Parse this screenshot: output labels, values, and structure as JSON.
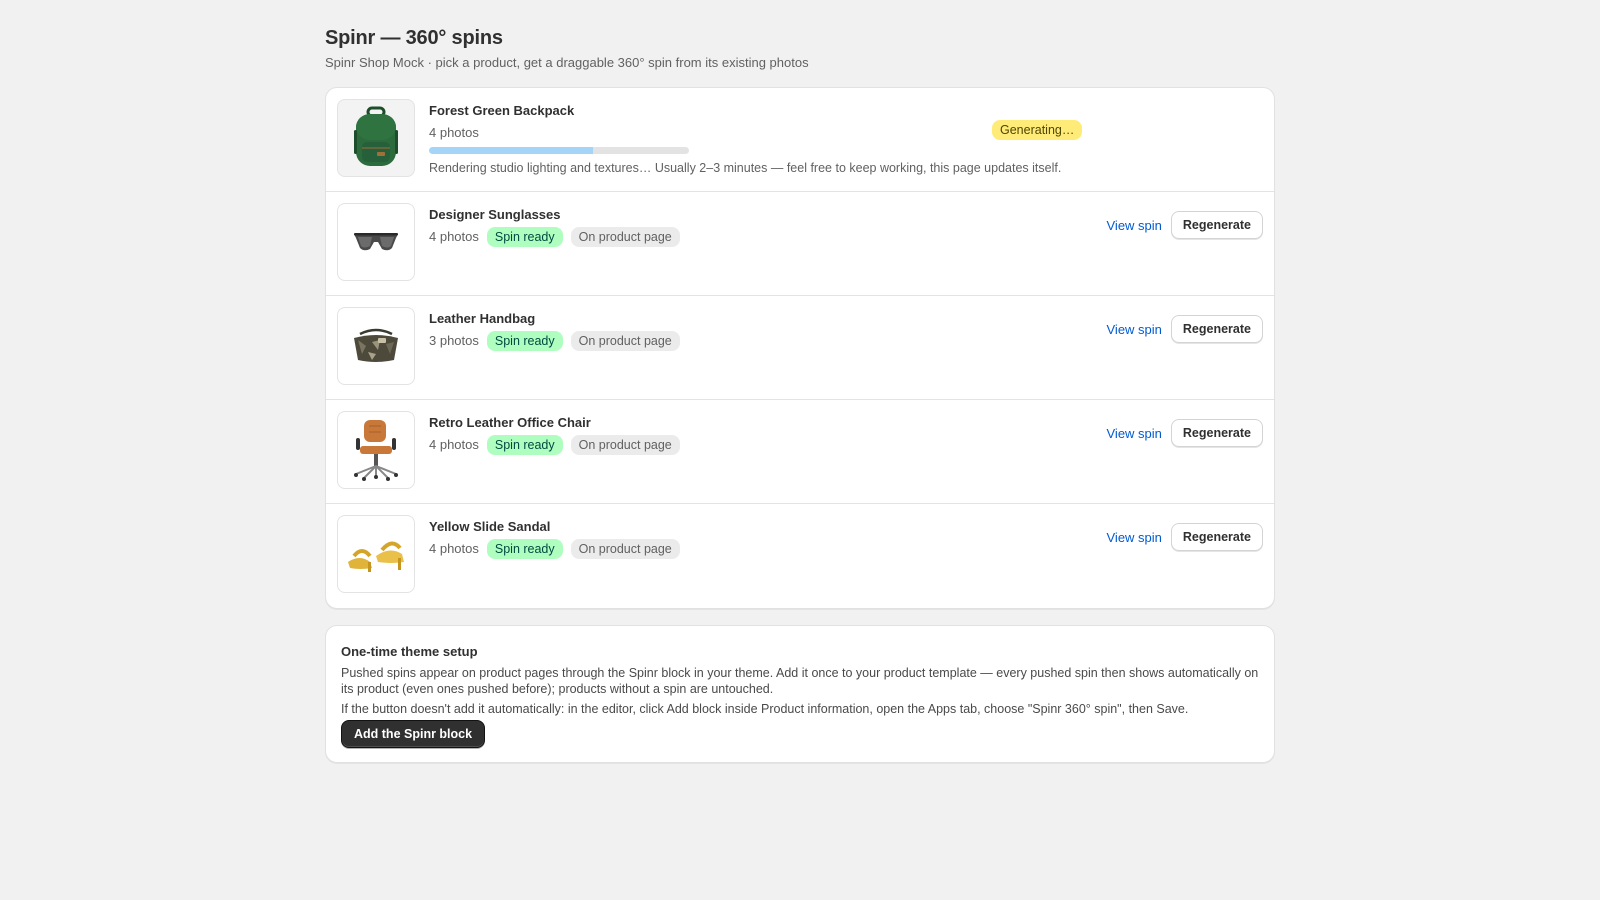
{
  "header": {
    "title": "Spinr — 360° spins",
    "subtitle": "Spinr Shop Mock · pick a product, get a draggable 360° spin from its existing photos"
  },
  "generating": {
    "name": "Forest Green Backpack",
    "photos": "4 photos",
    "status": "Generating…",
    "progress": 0.63,
    "message": "Rendering studio lighting and textures… Usually 2–3 minutes — feel free to keep working, this page updates itself.",
    "thumb_icon": "backpack-icon"
  },
  "products": [
    {
      "name": "Designer Sunglasses",
      "photos": "4 photos",
      "status": "Spin ready",
      "placement": "On product page",
      "view_label": "View spin",
      "regen_label": "Regenerate",
      "thumb_icon": "sunglasses-icon"
    },
    {
      "name": "Leather Handbag",
      "photos": "3 photos",
      "status": "Spin ready",
      "placement": "On product page",
      "view_label": "View spin",
      "regen_label": "Regenerate",
      "thumb_icon": "handbag-icon"
    },
    {
      "name": "Retro Leather Office Chair",
      "photos": "4 photos",
      "status": "Spin ready",
      "placement": "On product page",
      "view_label": "View spin",
      "regen_label": "Regenerate",
      "thumb_icon": "office-chair-icon"
    },
    {
      "name": "Yellow Slide Sandal",
      "photos": "4 photos",
      "status": "Spin ready",
      "placement": "On product page",
      "view_label": "View spin",
      "regen_label": "Regenerate",
      "thumb_icon": "sandal-icon"
    }
  ],
  "setup": {
    "title": "One-time theme setup",
    "body": "Pushed spins appear on product pages through the Spinr block in your theme. Add it once to your product template — every pushed spin then shows automatically on its product (even ones pushed before); products without a spin are untouched.",
    "hint": "If the button doesn't add it automatically: in the editor, click Add block inside Product information, open the Apps tab, choose \"Spinr 360° spin\", then Save.",
    "button_label": "Add the Spinr block"
  },
  "colors": {
    "generating_badge": "#ffeb78",
    "ready_badge": "#affebf",
    "link": "#005bd3",
    "progress": "#a4d4f7"
  }
}
